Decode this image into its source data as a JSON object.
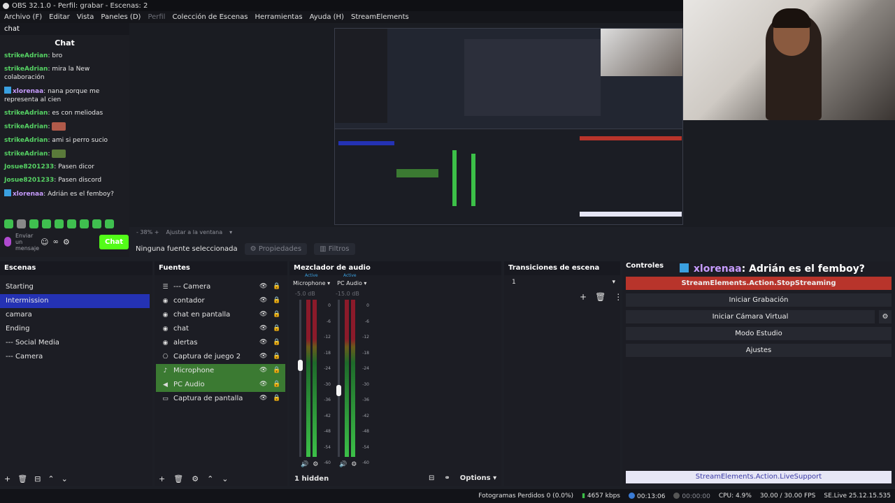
{
  "window": {
    "title": "OBS 32.1.0 - Perfil: grabar - Escenas: 2"
  },
  "menu": [
    "Archivo (F)",
    "Editar",
    "Vista",
    "Paneles (D)",
    "Perfil",
    "Colección de Escenas",
    "Herramientas",
    "Ayuda (H)",
    "StreamElements"
  ],
  "chat_dock": {
    "tab": "chat",
    "header": "Chat",
    "messages": [
      {
        "user": "strikeAdrian",
        "text": "bro",
        "color": "green"
      },
      {
        "user": "strikeAdrian",
        "text": "mira la New colaboración",
        "color": "green"
      },
      {
        "user": "xlorenaa",
        "text": "nana porque me representa al cien",
        "color": "purple"
      },
      {
        "user": "strikeAdrian",
        "text": "es con meliodas",
        "color": "green"
      },
      {
        "user": "strikeAdrian",
        "text": "",
        "color": "green"
      },
      {
        "user": "strikeAdrian",
        "text": "ami si perro sucio",
        "color": "green"
      },
      {
        "user": "strikeAdrian",
        "text": "",
        "color": "green"
      },
      {
        "user": "Josue8201233",
        "text": "Pasen dicor",
        "color": "green"
      },
      {
        "user": "Josue8201233",
        "text": "Pasen discord",
        "color": "green"
      },
      {
        "user": "xlorenaa",
        "text": "Adrián es el femboy?",
        "color": "purple"
      }
    ],
    "send_placeholder": "Enviar un mensaje",
    "chat_button": "Chat"
  },
  "preview": {
    "zoom": "- 38% +",
    "fit": "Ajustar a la ventana"
  },
  "source_bar": {
    "none": "Ninguna fuente seleccionada",
    "properties": "Propiedades",
    "filters": "Filtros"
  },
  "scenes": {
    "title": "Escenas",
    "items": [
      "Starting",
      "Intermission",
      "camara",
      "Ending",
      "--- Social Media",
      "--- Camera"
    ],
    "selected": 1
  },
  "sources": {
    "title": "Fuentes",
    "items": [
      {
        "label": "--- Camera",
        "icon": "list"
      },
      {
        "label": "contador",
        "icon": "globe"
      },
      {
        "label": "chat en pantalla",
        "icon": "globe"
      },
      {
        "label": "chat",
        "icon": "globe"
      },
      {
        "label": "alertas",
        "icon": "globe"
      },
      {
        "label": "Captura de juego 2",
        "icon": "gamepad"
      },
      {
        "label": "Microphone",
        "icon": "mic"
      },
      {
        "label": "PC Audio",
        "icon": "speaker"
      },
      {
        "label": "Captura de pantalla",
        "icon": "monitor"
      }
    ]
  },
  "mixer": {
    "title": "Mezclador de audio",
    "channels": [
      {
        "name": "Microphone",
        "status": "Active",
        "db": "-5.0 dB",
        "fader_level": 0.62
      },
      {
        "name": "PC Audio",
        "status": "Active",
        "db": "-15.0 dB",
        "fader_level": 0.46
      }
    ],
    "scale": [
      "0",
      "-6",
      "-12",
      "-18",
      "-24",
      "-30",
      "-36",
      "-42",
      "-48",
      "-54",
      "-60"
    ],
    "hidden": "1 hidden",
    "options": "Options"
  },
  "transitions": {
    "title": "Transiciones de escena",
    "value": "1"
  },
  "controls": {
    "title": "Controles",
    "alert_user": "xlorenaa",
    "alert_text": ": Adrián es el femboy?",
    "buttons": [
      "StreamElements.Action.StopStreaming",
      "Iniciar Grabación",
      "Iniciar Cámara Virtual",
      "Modo Estudio",
      "Ajustes"
    ],
    "support": "StreamElements.Action.LiveSupport"
  },
  "status": {
    "dropped": "Fotogramas Perdidos 0 (0.0%)",
    "bitrate": "4657 kbps",
    "stream_time": "00:13:06",
    "rec_time": "00:00:00",
    "cpu": "CPU: 4.9%",
    "fps": "30.00 / 30.00 FPS",
    "se": "SE.Live 25.12.15.535"
  },
  "colors": {
    "accent": "#2432b4",
    "green_row": "#3b7a32",
    "stop": "#b8342b",
    "kick": "#53fc18"
  }
}
